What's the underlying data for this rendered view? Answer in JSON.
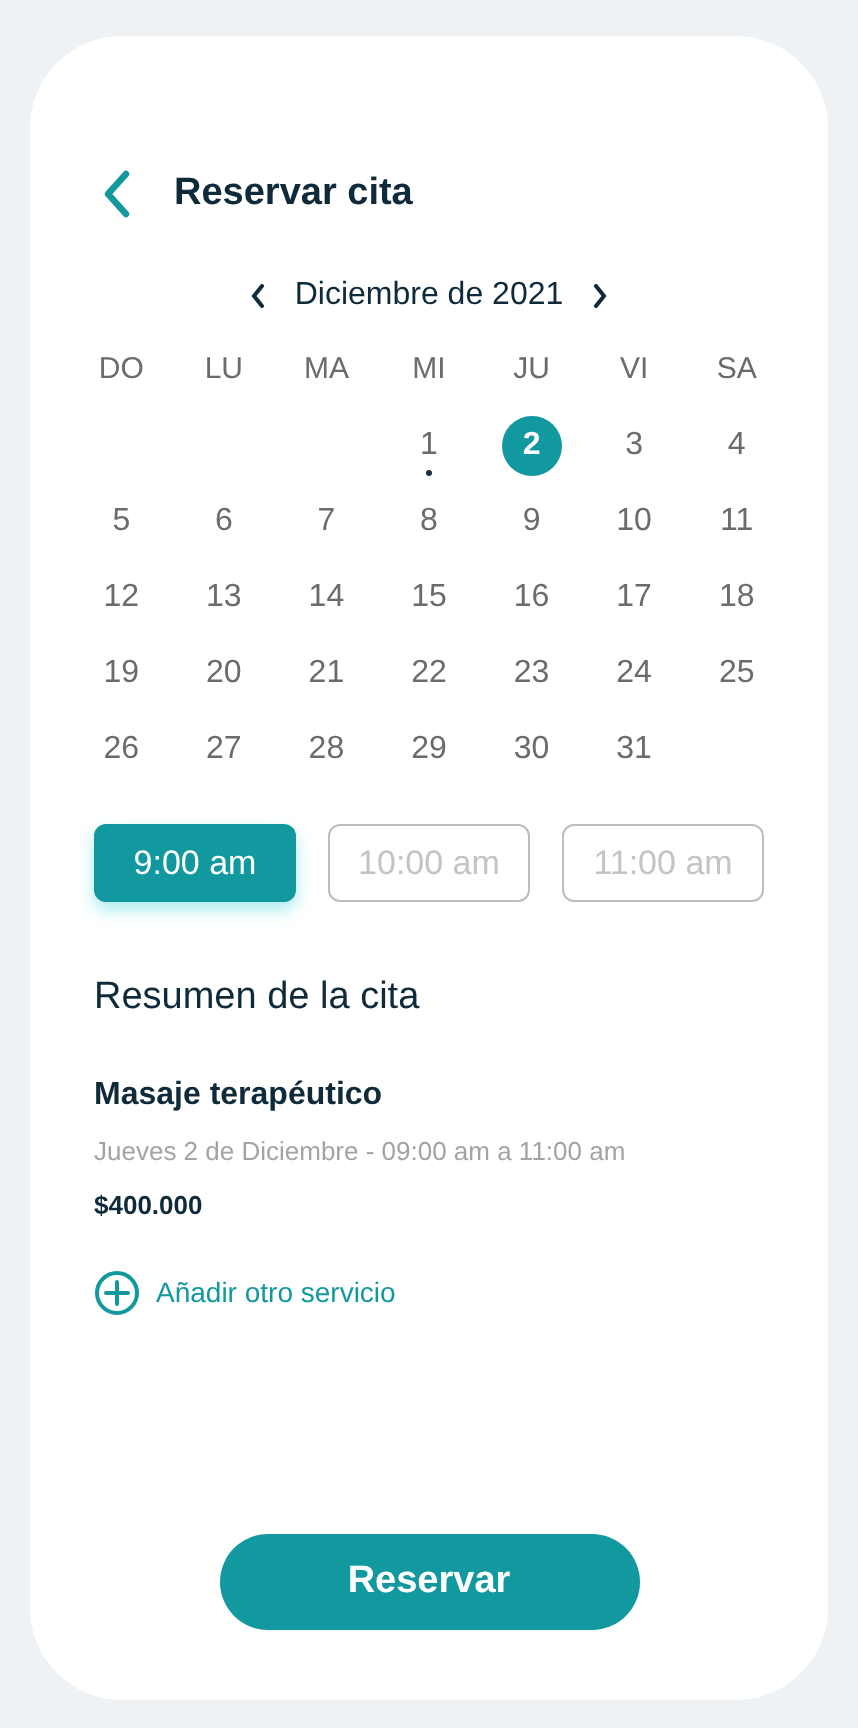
{
  "header": {
    "title": "Reservar cita"
  },
  "calendar": {
    "month": "Diciembre de 2021",
    "weekdays": [
      "DO",
      "LU",
      "MA",
      "MI",
      "JU",
      "VI",
      "SA"
    ],
    "weeks": [
      [
        {
          "label": "1",
          "selected": false,
          "marked": true
        },
        {
          "label": "2",
          "selected": true,
          "marked": false
        },
        {
          "label": "3",
          "selected": false,
          "marked": false
        },
        {
          "label": "4",
          "selected": false,
          "marked": false
        }
      ],
      [
        {
          "label": "5",
          "selected": false,
          "marked": false
        },
        {
          "label": "6",
          "selected": false,
          "marked": false
        },
        {
          "label": "7",
          "selected": false,
          "marked": false
        },
        {
          "label": "8",
          "selected": false,
          "marked": false
        },
        {
          "label": "9",
          "selected": false,
          "marked": false
        },
        {
          "label": "10",
          "selected": false,
          "marked": false
        },
        {
          "label": "11",
          "selected": false,
          "marked": false
        }
      ],
      [
        {
          "label": "12",
          "selected": false,
          "marked": false
        },
        {
          "label": "13",
          "selected": false,
          "marked": false
        },
        {
          "label": "14",
          "selected": false,
          "marked": false
        },
        {
          "label": "15",
          "selected": false,
          "marked": false
        },
        {
          "label": "16",
          "selected": false,
          "marked": false
        },
        {
          "label": "17",
          "selected": false,
          "marked": false
        },
        {
          "label": "18",
          "selected": false,
          "marked": false
        }
      ],
      [
        {
          "label": "19",
          "selected": false,
          "marked": false
        },
        {
          "label": "20",
          "selected": false,
          "marked": false
        },
        {
          "label": "21",
          "selected": false,
          "marked": false
        },
        {
          "label": "22",
          "selected": false,
          "marked": false
        },
        {
          "label": "23",
          "selected": false,
          "marked": false
        },
        {
          "label": "24",
          "selected": false,
          "marked": false
        },
        {
          "label": "25",
          "selected": false,
          "marked": false
        }
      ],
      [
        {
          "label": "26",
          "selected": false,
          "marked": false
        },
        {
          "label": "27",
          "selected": false,
          "marked": false
        },
        {
          "label": "28",
          "selected": false,
          "marked": false
        },
        {
          "label": "29",
          "selected": false,
          "marked": false
        },
        {
          "label": "30",
          "selected": false,
          "marked": false
        },
        {
          "label": "31",
          "selected": false,
          "marked": false
        }
      ]
    ]
  },
  "time_slots": [
    {
      "label": "9:00 am",
      "selected": true
    },
    {
      "label": "10:00 am",
      "selected": false
    },
    {
      "label": "11:00 am",
      "selected": false
    }
  ],
  "summary": {
    "title": "Resumen de la cita",
    "service": "Masaje terapéutico",
    "schedule": "Jueves 2 de Diciembre - 09:00 am a 11:00 am",
    "price": "$400.000",
    "add_link": "Añadir otro servicio"
  },
  "submit": "Reservar"
}
